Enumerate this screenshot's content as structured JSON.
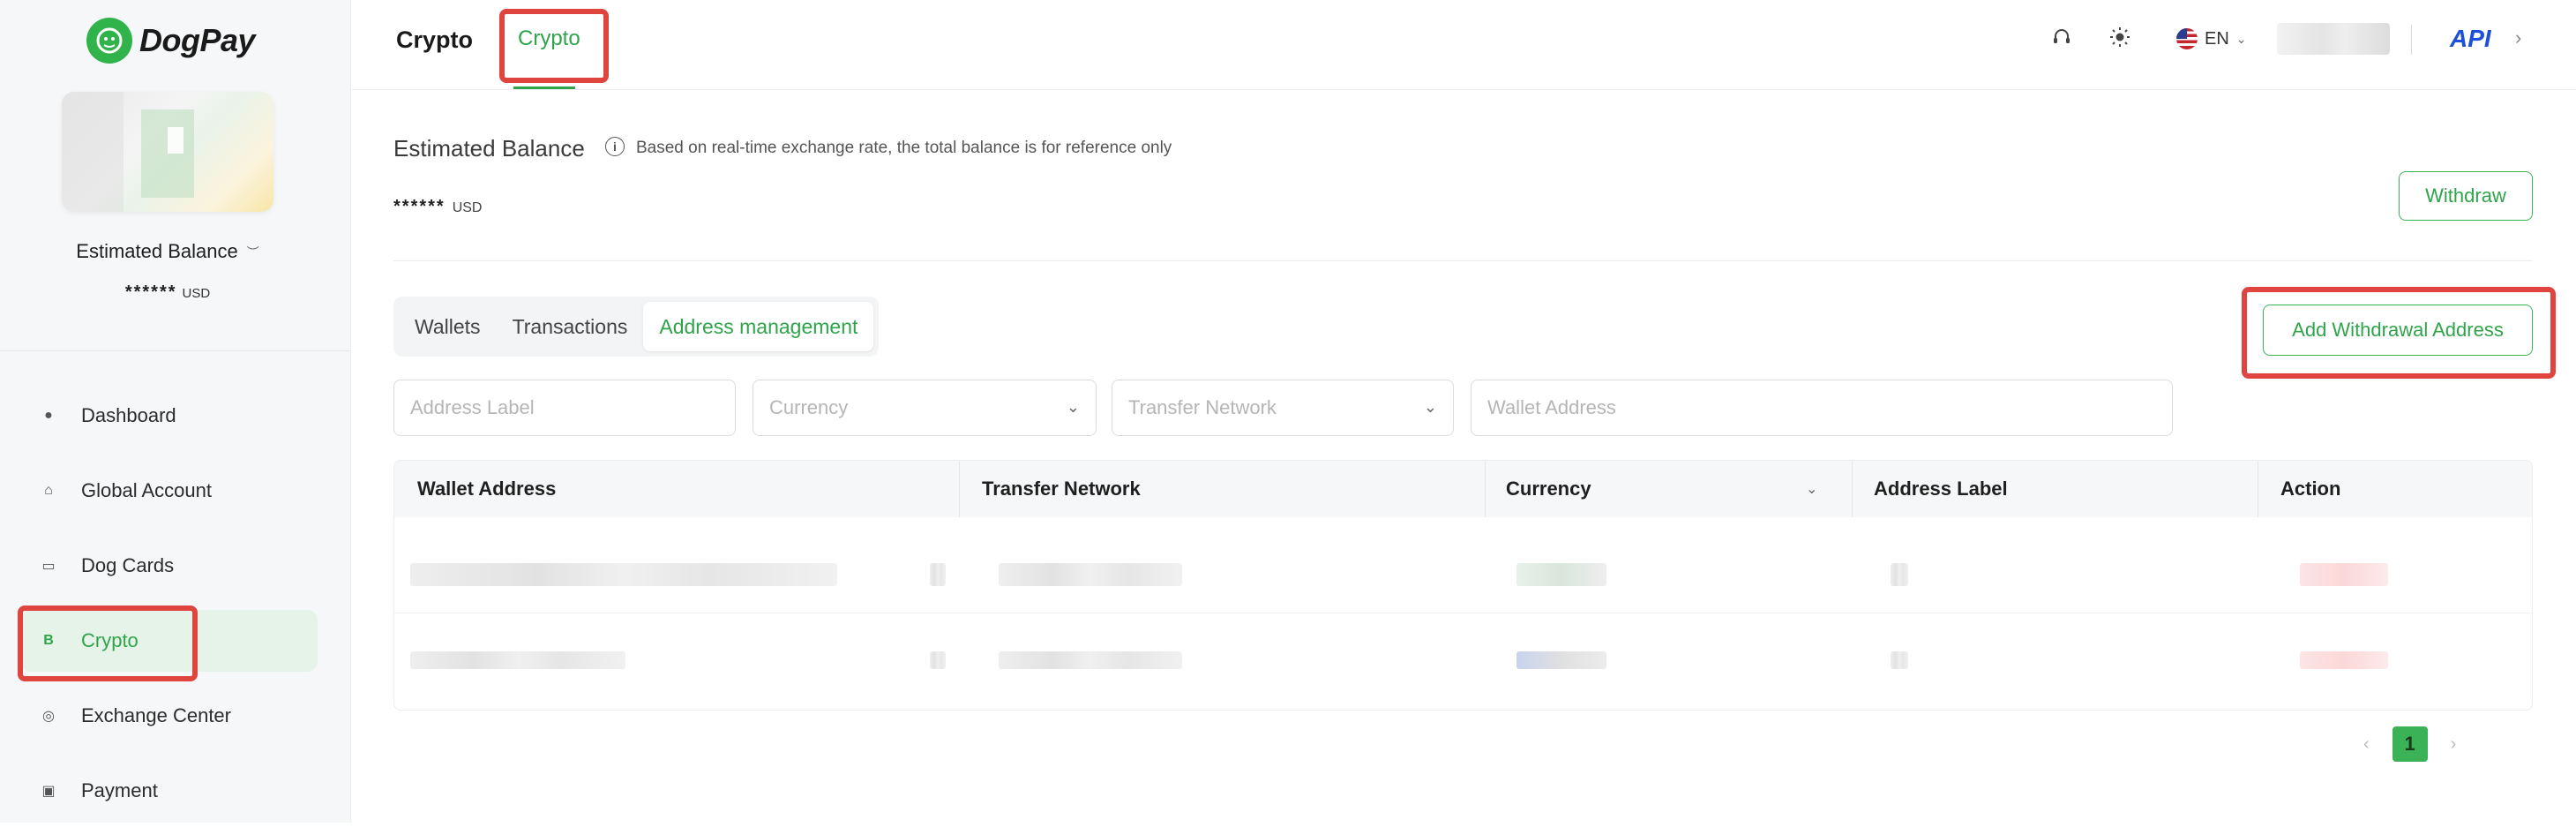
{
  "brand": {
    "name": "DogPay"
  },
  "sidebar": {
    "balance_label": "Estimated Balance",
    "balance_value": "******",
    "balance_unit": "USD",
    "items": [
      {
        "label": "Dashboard",
        "icon": "dashboard-icon"
      },
      {
        "label": "Global Account",
        "icon": "bank-icon"
      },
      {
        "label": "Dog Cards",
        "icon": "card-icon"
      },
      {
        "label": "Crypto",
        "icon": "bitcoin-icon"
      },
      {
        "label": "Exchange Center",
        "icon": "exchange-icon"
      },
      {
        "label": "Payment",
        "icon": "wallet-icon"
      }
    ]
  },
  "header": {
    "title": "Crypto",
    "tab": "Crypto",
    "language": "EN",
    "api_label": "API"
  },
  "balance": {
    "title": "Estimated Balance",
    "note": "Based on real-time exchange rate, the total balance is for reference only",
    "value": "******",
    "unit": "USD",
    "withdraw_label": "Withdraw"
  },
  "tabs": [
    {
      "label": "Wallets"
    },
    {
      "label": "Transactions"
    },
    {
      "label": "Address management",
      "active": true
    }
  ],
  "add_address_label": "Add Withdrawal Address",
  "filters": {
    "address_label_placeholder": "Address Label",
    "currency_placeholder": "Currency",
    "network_placeholder": "Transfer Network",
    "wallet_address_placeholder": "Wallet Address"
  },
  "table": {
    "columns": [
      "Wallet Address",
      "Transfer Network",
      "Currency",
      "Address Label",
      "Action"
    ]
  },
  "pagination": {
    "current": "1",
    "prev": "‹",
    "next": "›"
  },
  "colors": {
    "accent": "#2fa44a",
    "highlight": "#e0443e",
    "api": "#1d4fd8"
  }
}
